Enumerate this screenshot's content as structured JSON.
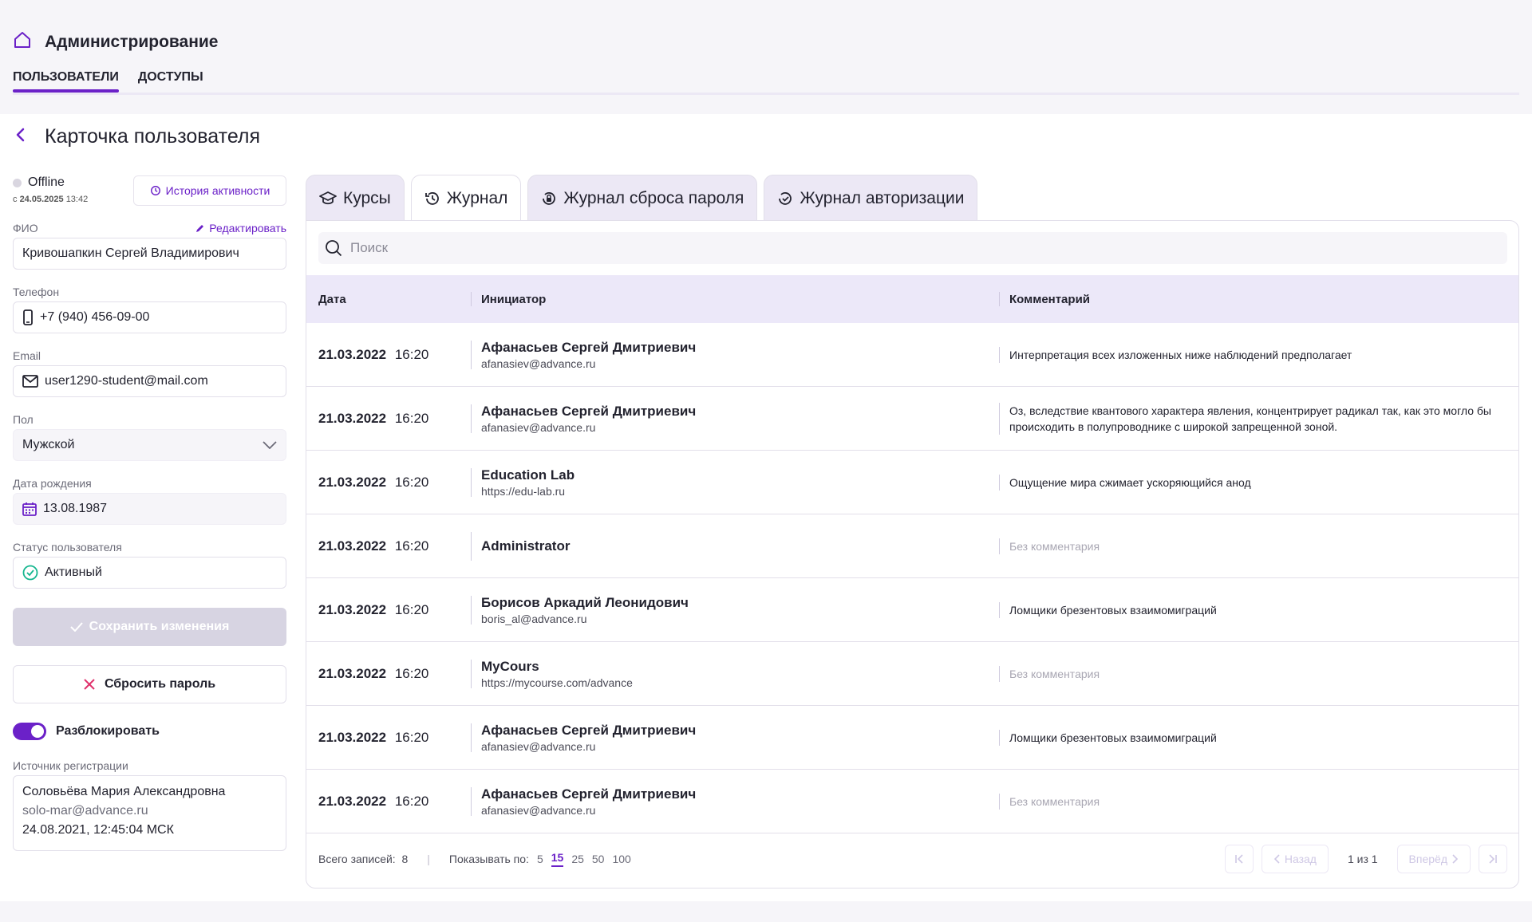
{
  "header": {
    "title": "Администрирование",
    "tabs": [
      {
        "label": "ПОЛЬЗОВАТЕЛИ"
      },
      {
        "label": "ДОСТУПЫ"
      }
    ]
  },
  "card": {
    "title": "Карточка пользователя"
  },
  "left": {
    "status": "Offline",
    "since_prefix": "с",
    "since_date": "24.05.2025",
    "since_time": "13:42",
    "history_button": "История активности",
    "fio_label": "ФИО",
    "edit_label": "Редактировать",
    "fio_value": "Кривошапкин Сергей Владимирович",
    "phone_label": "Телефон",
    "phone_value": "+7 (940) 456-09-00",
    "email_label": "Email",
    "email_value": "user1290-student@mail.com",
    "gender_label": "Пол",
    "gender_value": "Мужской",
    "birth_label": "Дата рождения",
    "birth_value": "13.08.1987",
    "status_label": "Статус пользователя",
    "status_value": "Активный",
    "save_button": "Сохранить изменения",
    "reset_button": "Сбросить пароль",
    "unblock_label": "Разблокировать",
    "source_label": "Источник регистрации",
    "source_name": "Соловьёва Мария Александровна",
    "source_email": "solo-mar@advance.ru",
    "source_date": "24.08.2021, 12:45:04 МСК"
  },
  "tabs": [
    {
      "label": "Курсы",
      "icon": "graduation-cap-icon"
    },
    {
      "label": "Журнал",
      "icon": "history-icon"
    },
    {
      "label": "Журнал сброса пароля",
      "icon": "lock-reset-icon"
    },
    {
      "label": "Журнал авторизации",
      "icon": "login-check-icon"
    }
  ],
  "search": {
    "placeholder": "Поиск"
  },
  "table": {
    "columns": [
      "Дата",
      "Инициатор",
      "Комментарий"
    ],
    "rows": [
      {
        "date": "21.03.2022",
        "time": "16:20",
        "name": "Афанасьев Сергей Дмитриевич",
        "email": "afanasiev@advance.ru",
        "comment": "Интерпретация всех изложенных ниже наблюдений предполагает"
      },
      {
        "date": "21.03.2022",
        "time": "16:20",
        "name": "Афанасьев Сергей Дмитриевич",
        "email": "afanasiev@advance.ru",
        "comment": "Оз, вследствие квантового характера явления, концентрирует радикал так, как это могло бы происходить в полупроводнике с широкой запрещенной зоной."
      },
      {
        "date": "21.03.2022",
        "time": "16:20",
        "name": "Education Lab",
        "email": "https://edu-lab.ru",
        "comment": "Ощущение мира сжимает ускоряющийся анод"
      },
      {
        "date": "21.03.2022",
        "time": "16:20",
        "name": "Administrator",
        "email": "",
        "comment": "Без комментария",
        "empty": true
      },
      {
        "date": "21.03.2022",
        "time": "16:20",
        "name": "Борисов Аркадий Леонидович",
        "email": "boris_al@advance.ru",
        "comment": "Ломщики брезентовых взаимомиграций"
      },
      {
        "date": "21.03.2022",
        "time": "16:20",
        "name": "MyCours",
        "email": "https://mycourse.com/advance",
        "comment": "Без комментария",
        "empty": true
      },
      {
        "date": "21.03.2022",
        "time": "16:20",
        "name": "Афанасьев Сергей Дмитриевич",
        "email": "afanasiev@advance.ru",
        "comment": "Ломщики брезентовых взаимомиграций"
      },
      {
        "date": "21.03.2022",
        "time": "16:20",
        "name": "Афанасьев Сергей Дмитриевич",
        "email": "afanasiev@advance.ru",
        "comment": "Без комментария",
        "empty": true
      }
    ]
  },
  "footer": {
    "total_label": "Всего записей:",
    "total": "8",
    "show_label": "Показывать по:",
    "page_sizes": [
      "5",
      "15",
      "25",
      "50",
      "100"
    ],
    "active_size": "15",
    "prev": "Назад",
    "next": "Вперёд",
    "page_info": "1 из 1"
  },
  "colors": {
    "accent": "#6b21c8",
    "header_bg": "#ece8f9",
    "success": "#16b68f",
    "danger": "#e0316b"
  }
}
